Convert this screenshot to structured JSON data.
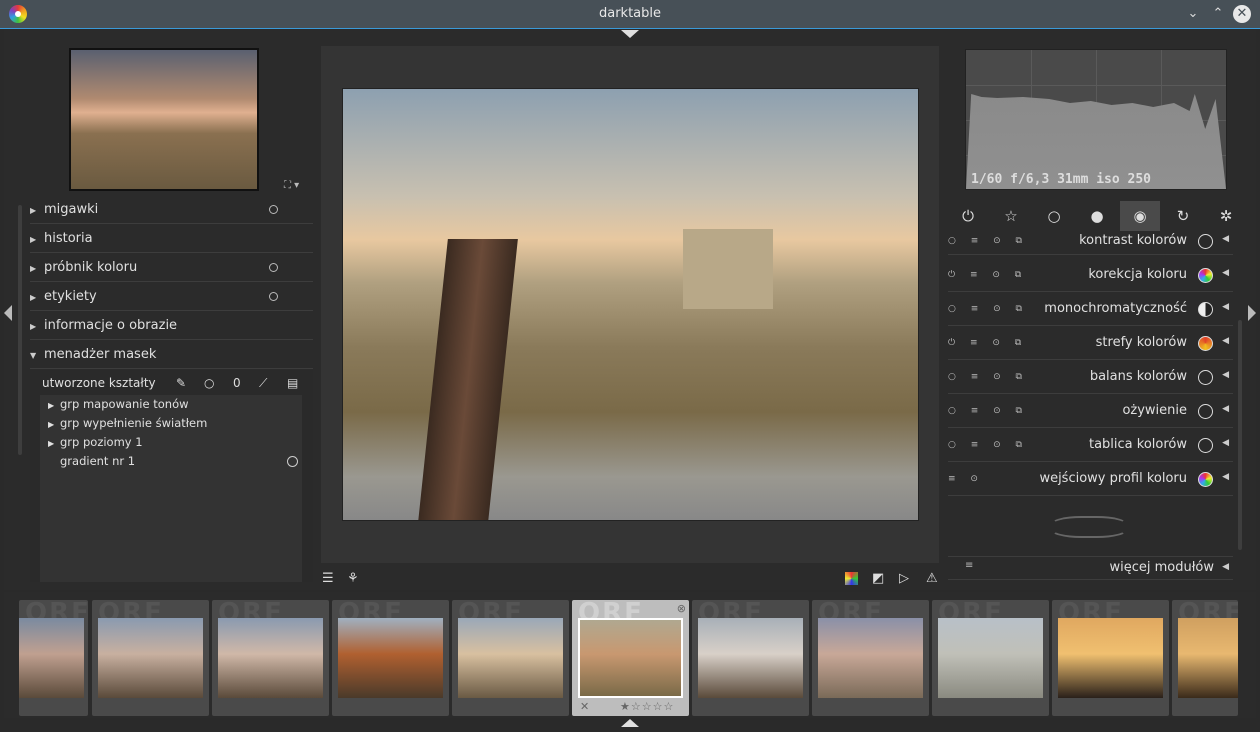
{
  "window": {
    "title": "darktable"
  },
  "left_panel": {
    "modules": [
      {
        "label": "migawki",
        "expanded": false,
        "has_dot": true
      },
      {
        "label": "historia",
        "expanded": false,
        "has_dot": false
      },
      {
        "label": "próbnik koloru",
        "expanded": false,
        "has_dot": true
      },
      {
        "label": "etykiety",
        "expanded": false,
        "has_dot": true
      },
      {
        "label": "informacje o obrazie",
        "expanded": false,
        "has_dot": false
      },
      {
        "label": "menadżer masek",
        "expanded": true,
        "has_dot": false
      }
    ],
    "mask_manager": {
      "header": "utworzone kształty",
      "items": [
        {
          "label": "grp mapowanie tonów",
          "expandable": true
        },
        {
          "label": "grp wypełnienie światłem",
          "expandable": true
        },
        {
          "label": "grp poziomy 1",
          "expandable": true
        },
        {
          "label": "gradient nr 1",
          "expandable": false
        }
      ]
    }
  },
  "right_panel": {
    "exif": "1/60 f/6,3 31mm iso 250",
    "groups": [
      "power-icon",
      "star-icon",
      "circle-icon",
      "sphere-icon",
      "color-wheel-icon",
      "correct-icon",
      "effect-icon"
    ],
    "active_group": 4,
    "modules": [
      {
        "label": "kontrast kolorów",
        "swatch": "#2a2a2a",
        "enabled": false
      },
      {
        "label": "korekcja koloru",
        "swatch": "conic",
        "enabled": true
      },
      {
        "label": "monochromatyczność",
        "swatch": "half",
        "enabled": false
      },
      {
        "label": "strefy kolorów",
        "swatch": "#e0402a",
        "enabled": true
      },
      {
        "label": "balans kolorów",
        "swatch": "#2a2a2a",
        "enabled": false
      },
      {
        "label": "ożywienie",
        "swatch": "#2a2a2a",
        "enabled": false
      },
      {
        "label": "tablica kolorów",
        "swatch": "#2a2a2a",
        "enabled": false
      },
      {
        "label": "wejściowy profil koloru",
        "swatch": "conic",
        "enabled": true
      }
    ],
    "more_modules": "więcej modułów"
  },
  "filmstrip": {
    "watermark": "ORF",
    "selected_index": 5,
    "thumbs": [
      {
        "colors": [
          "#7a8aa0",
          "#c0a090",
          "#5a4a3a"
        ]
      },
      {
        "colors": [
          "#8a9ab0",
          "#c8b0a0",
          "#5a4a3a"
        ]
      },
      {
        "colors": [
          "#8a9ab0",
          "#d0b8a8",
          "#5a4a3a"
        ]
      },
      {
        "colors": [
          "#a0b0c0",
          "#b06030",
          "#4a3a2a"
        ]
      },
      {
        "colors": [
          "#9aa8b8",
          "#d8c0a0",
          "#6a5a44"
        ]
      },
      {
        "colors": [
          "#b0a890",
          "#c89870",
          "#7a6a48"
        ]
      },
      {
        "colors": [
          "#a8b0b8",
          "#d8d0c8",
          "#5a4a3a"
        ]
      },
      {
        "colors": [
          "#8a90a8",
          "#c8a898",
          "#7a6a58"
        ]
      },
      {
        "colors": [
          "#b8c0c8",
          "#c0c0b8",
          "#8a8a80"
        ]
      },
      {
        "colors": [
          "#e0a860",
          "#f0c070",
          "#2a201a"
        ]
      },
      {
        "colors": [
          "#d0a060",
          "#e8b870",
          "#3a2a1a"
        ]
      }
    ]
  },
  "colors": {
    "accent": "#3a9ad9",
    "titlebar": "#475057"
  }
}
